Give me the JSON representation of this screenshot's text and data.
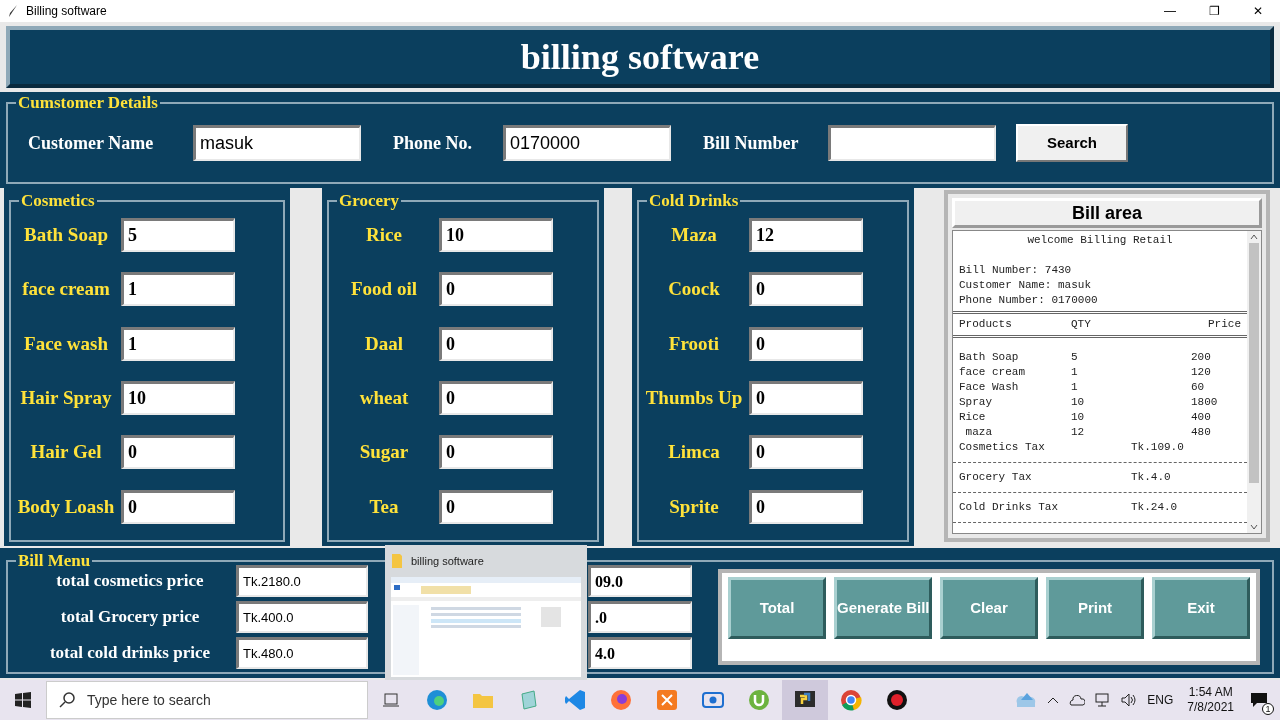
{
  "window": {
    "title": "Billing software",
    "controls": [
      "—",
      "❐",
      "✕"
    ]
  },
  "header": {
    "title": "billing software"
  },
  "customer": {
    "legend": "Cumstomer Details",
    "fields": [
      {
        "label": "Customer Name",
        "value": "masuk"
      },
      {
        "label": "Phone No.",
        "value": "0170000"
      },
      {
        "label": "Bill Number"
      }
    ],
    "search_button": "Search"
  },
  "categories": [
    {
      "legend": "Cosmetics",
      "items": [
        {
          "label": "Bath Soap",
          "value": "5"
        },
        {
          "label": "face cream",
          "value": "1"
        },
        {
          "label": "Face wash",
          "value": "1"
        },
        {
          "label": "Hair Spray",
          "value": "10"
        },
        {
          "label": "Hair Gel",
          "value": "0"
        },
        {
          "label": "Body Loash",
          "value": "0"
        }
      ]
    },
    {
      "legend": "Grocery",
      "items": [
        {
          "label": "Rice",
          "value": "10"
        },
        {
          "label": "Food oil",
          "value": "0"
        },
        {
          "label": "Daal",
          "value": "0"
        },
        {
          "label": "wheat",
          "value": "0"
        },
        {
          "label": "Sugar",
          "value": "0"
        },
        {
          "label": "Tea",
          "value": "0"
        }
      ]
    },
    {
      "legend": "Cold Drinks",
      "items": [
        {
          "label": "Maza",
          "value": "12"
        },
        {
          "label": "Coock",
          "value": "0"
        },
        {
          "label": "Frooti",
          "value": "0"
        },
        {
          "label": "Thumbs Up",
          "value": "0"
        },
        {
          "label": "Limca",
          "value": "0"
        },
        {
          "label": "Sprite",
          "value": "0"
        }
      ]
    }
  ],
  "bill_area": {
    "title": "Bill area",
    "welcome": "welcome Billing Retail",
    "info": [
      "Bill Number: 7430",
      "Customer Name: masuk",
      "Phone Number: 0170000"
    ],
    "columns": [
      "Products",
      "QTY",
      "Price"
    ],
    "items": [
      [
        "Bath Soap",
        "5",
        "200"
      ],
      [
        "face cream",
        "1",
        "120"
      ],
      [
        "Face Wash",
        "1",
        "60"
      ],
      [
        "Spray",
        "10",
        "1800"
      ],
      [
        "Rice",
        "10",
        "400"
      ],
      [
        " maza",
        "12",
        "480"
      ]
    ],
    "taxes": [
      [
        "Cosmetics Tax",
        "Tk.109.0"
      ],
      [
        "Grocery Tax",
        "Tk.4.0"
      ],
      [
        "Cold Drinks Tax",
        "Tk.24.0"
      ]
    ]
  },
  "bill_menu": {
    "legend": "Bill Menu",
    "totals": [
      {
        "label": "total cosmetics price",
        "value": "Tk.2180.0"
      },
      {
        "label": "total Grocery price",
        "value": "Tk.400.0"
      },
      {
        "label": "total cold drinks price",
        "value": "Tk.480.0"
      }
    ],
    "tax_values": [
      "09.0",
      ".0",
      "4.0"
    ],
    "buttons": [
      "Total",
      "Generate Bill",
      "Clear",
      "Print",
      "Exit"
    ]
  },
  "thumbnail": {
    "title": "billing software"
  },
  "taskbar": {
    "search_placeholder": "Type here to search",
    "language": "ENG",
    "time": "1:54 AM",
    "date": "7/8/2021",
    "notification_count": "1"
  }
}
